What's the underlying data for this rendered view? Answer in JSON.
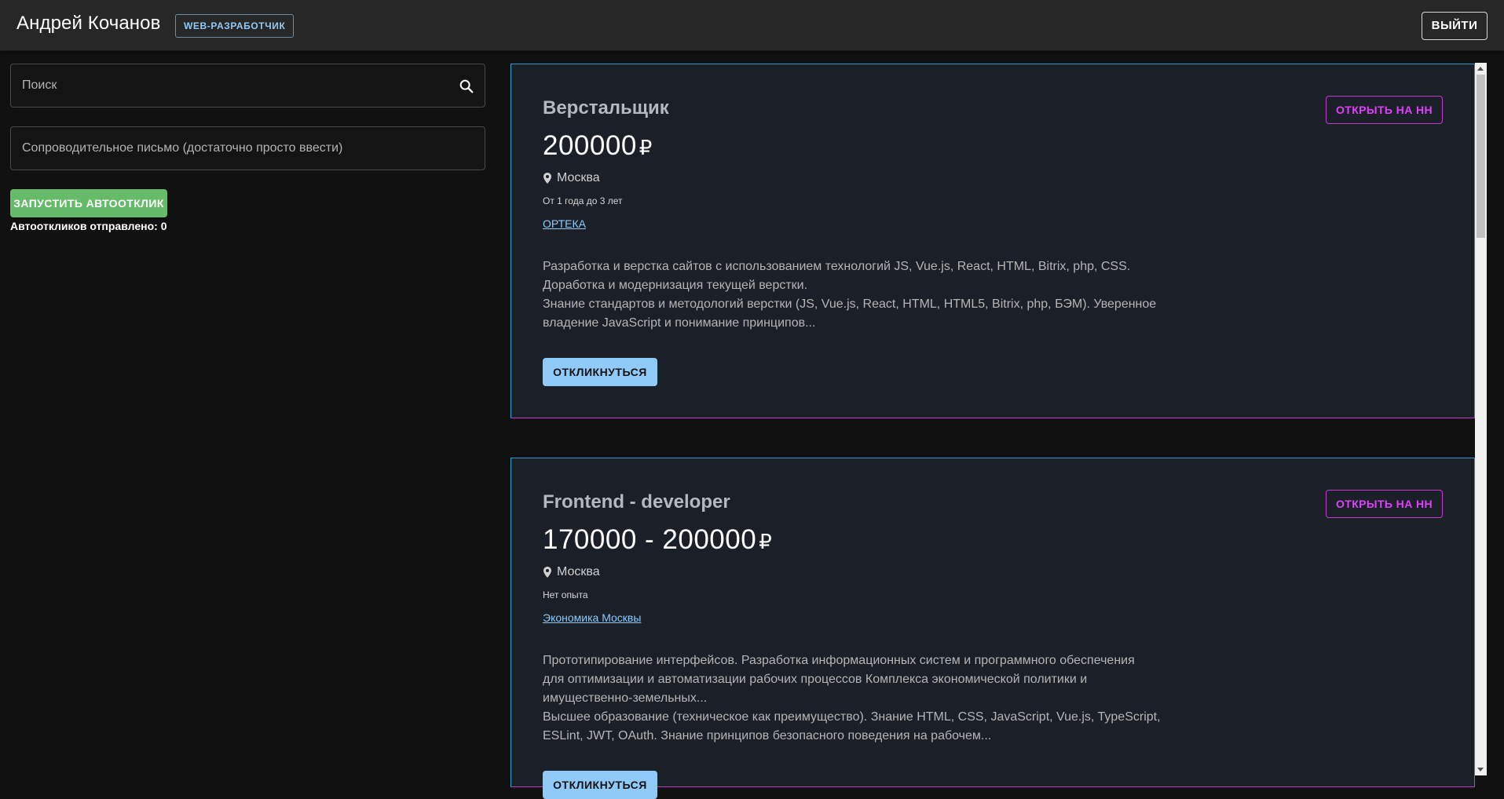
{
  "header": {
    "user_name": "Андрей Кочанов",
    "role_badge": "WEB-РАЗРАБОТЧИК",
    "logout_label": "ВЫЙТИ"
  },
  "sidebar": {
    "search": {
      "placeholder": "Поиск",
      "value": ""
    },
    "cover_letter": {
      "placeholder": "Сопроводительное письмо (достаточно просто ввести)",
      "value": ""
    },
    "start_button_label": "ЗАПУСТИТЬ АВТООТКЛИК",
    "sent_count_text": "Автооткликов отправлено: 0"
  },
  "vacancies": [
    {
      "title": "Верстальщик",
      "salary": "200000",
      "currency": "₽",
      "city": "Москва",
      "experience": "От 1 года до 3 лет",
      "company": "ОРТЕКА",
      "description": [
        "Разработка и верстка сайтов с использованием технологий JS, Vue.js, React, HTML, Bitrix, php, CSS.",
        "Доработка и модернизация текущей верстки.",
        "Знание стандартов и методологий верстки (JS, Vue.js, React, HTML, HTML5, Bitrix, php, БЭМ). Уверенное",
        "владение JavaScript и понимание принципов..."
      ],
      "apply_label": "ОТКЛИКНУТЬСЯ",
      "open_hh_label": "ОТКРЫТЬ НА HH"
    },
    {
      "title": "Frontend - developer",
      "salary": "170000 - 200000",
      "currency": "₽",
      "city": "Москва",
      "experience": "Нет опыта",
      "company": "Экономика Москвы",
      "description": [
        "Прототипирование интерфейсов. Разработка информационных систем и программного обеспечения",
        "для оптимизации и автоматизации рабочих процессов Комплекса экономической политики и",
        "имущественно-земельных...",
        "Высшее образование (техническое как преимущество). Знание HTML, CSS, JavaScript, Vue.js, TypeScript,",
        "ESLint, JWT, OAuth. Знание принципов безопасного поведения на рабочем..."
      ],
      "apply_label": "ОТКЛИКНУТЬСЯ",
      "open_hh_label": "ОТКРЫТЬ НА HH"
    }
  ],
  "icons": {
    "search": "search-icon",
    "location": "location-pin-icon"
  },
  "colors": {
    "background": "#111111",
    "header": "#272727",
    "card": "#1b1f28",
    "primary": "#90caf9",
    "success": "#66bb6a",
    "accent": "#e040fb"
  }
}
